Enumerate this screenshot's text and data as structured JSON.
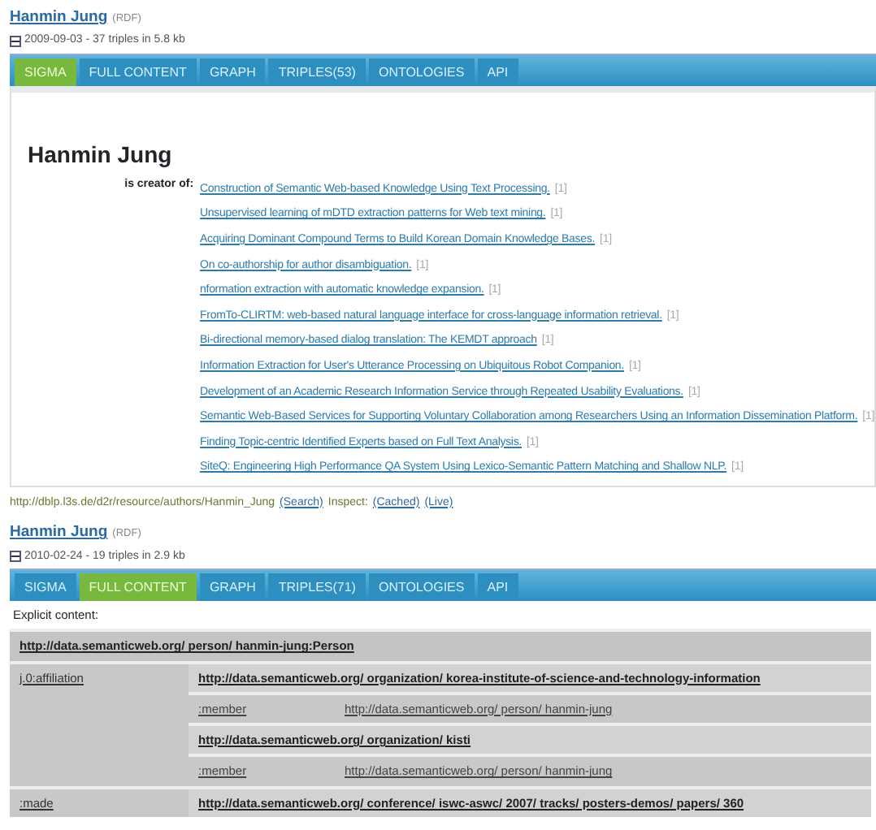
{
  "results": [
    {
      "title": "Hanmin Jung",
      "format": "(RDF)",
      "expanded": true,
      "meta": "2009-09-03 - 37 triples in 5.8 kb",
      "tabs": [
        {
          "label": "SIGMA",
          "selected": true
        },
        {
          "label": "FULL CONTENT",
          "selected": false
        },
        {
          "label": "GRAPH",
          "selected": false
        },
        {
          "label": "TRIPLES(53)",
          "selected": false
        },
        {
          "label": "ONTOLOGIES",
          "selected": false
        },
        {
          "label": "API",
          "selected": false
        }
      ],
      "sigma": {
        "heading": "Hanmin Jung",
        "property": "is creator of:",
        "items": [
          {
            "title": "Construction of Semantic Web-based Knowledge Using Text Processing.",
            "count": "[1]"
          },
          {
            "title": "Unsupervised learning of mDTD extraction patterns for Web text mining.",
            "count": "[1]"
          },
          {
            "title": "Acquiring Dominant Compound Terms to Build Korean Domain Knowledge Bases.",
            "count": "[1]"
          },
          {
            "title": "On co-authorship for author disambiguation.",
            "count": "[1]"
          },
          {
            "title": "nformation extraction with automatic knowledge expansion.",
            "count": "[1]"
          },
          {
            "title": "FromTo-CLIRTM: web-based natural language interface for cross-language information retrieval.",
            "count": "[1]"
          },
          {
            "title": "Bi-directional memory-based dialog translation: The KEMDT approach",
            "count": "[1]"
          },
          {
            "title": "Information Extraction for User's Utterance Processing on Ubiquitous Robot Companion.",
            "count": "[1]"
          },
          {
            "title": "Development of an Academic Research Information Service through Repeated Usability Evaluations.",
            "count": "[1]"
          },
          {
            "title": "Semantic Web-Based Services for Supporting Voluntary Collaboration among Researchers Using an Information Dissemination Platform.",
            "count": "[1]"
          },
          {
            "title": "Finding Topic-centric Identified Experts based on Full Text Analysis.",
            "count": "[1]"
          },
          {
            "title": "SiteQ: Engineering High Performance QA System Using Lexico-Semantic Pattern Matching and Shallow NLP.",
            "count": "[1]"
          }
        ]
      },
      "footer": {
        "url": "http://dblp.l3s.de/d2r/resource/authors/Hanmin_Jung",
        "links": [
          {
            "text": "(Search)",
            "kind": "link"
          },
          {
            "text": "Inspect:",
            "kind": "label"
          },
          {
            "text": "(Cached)",
            "kind": "link"
          },
          {
            "text": "(Live)",
            "kind": "link"
          }
        ]
      }
    },
    {
      "title": "Hanmin Jung",
      "format": "(RDF)",
      "expanded": true,
      "meta": "2010-02-24 - 19 triples in 2.9 kb",
      "tabs": [
        {
          "label": "SIGMA",
          "selected": false
        },
        {
          "label": "FULL CONTENT",
          "selected": true
        },
        {
          "label": "GRAPH",
          "selected": false
        },
        {
          "label": "TRIPLES(71)",
          "selected": false
        },
        {
          "label": "ONTOLOGIES",
          "selected": false
        },
        {
          "label": "API",
          "selected": false
        }
      ],
      "full_content": {
        "label": "Explicit content:",
        "subject": "http://data.semanticweb.org/ person/ hanmin-jung:Person",
        "properties": [
          {
            "name": "j.0:affiliation",
            "values": [
              {
                "uri": "http://data.semanticweb.org/ organization/ korea-institute-of-science-and-technology-information",
                "sub": [
                  {
                    "name": ":member",
                    "value": "http://data.semanticweb.org/ person/ hanmin-jung"
                  }
                ]
              },
              {
                "uri": "http://data.semanticweb.org/ organization/ kisti",
                "sub": [
                  {
                    "name": ":member",
                    "value": "http://data.semanticweb.org/ person/ hanmin-jung"
                  }
                ]
              }
            ]
          },
          {
            "name": ":made",
            "values": [
              {
                "uri": "http://data.semanticweb.org/ conference/ iswc-aswc/ 2007/ tracks/ posters-demos/ papers/ 360"
              }
            ]
          }
        ]
      }
    }
  ]
}
